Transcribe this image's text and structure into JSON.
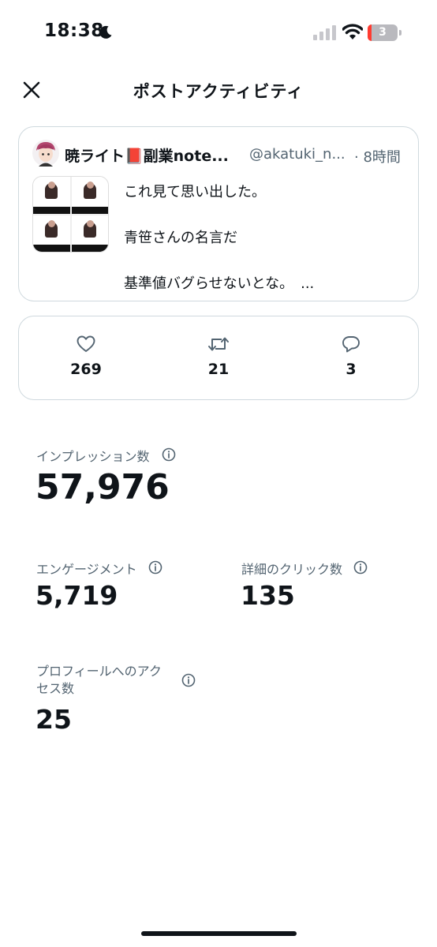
{
  "status_bar": {
    "time": "18:38",
    "battery_level": "3",
    "icons": [
      "moon-icon",
      "signal-icon",
      "wifi-icon",
      "battery-icon"
    ]
  },
  "header": {
    "title": "ポストアクティビティ",
    "close_icon": "close-icon"
  },
  "post": {
    "author_name": "暁ライト📕副業note...",
    "handle": "@akatuki_n...",
    "time": "· 8時間",
    "text_lines": [
      "これ見て思い出した。",
      "",
      "青笹さんの名言だ",
      "",
      "基準値バグらせないとな。　..."
    ]
  },
  "metrics": {
    "likes": "269",
    "reposts": "21",
    "replies": "3"
  },
  "stats": {
    "impressions_label": "インプレッション数",
    "impressions_value": "57,976",
    "engagement_label": "エンゲージメント",
    "engagement_value": "5,719",
    "detail_clicks_label": "詳細のクリック数",
    "detail_clicks_value": "135",
    "profile_visits_label_line1": "プロフィールへのアク",
    "profile_visits_label_line2": "セス数",
    "profile_visits_value": "25"
  },
  "colors": {
    "text_primary": "#0f1419",
    "text_secondary": "#536471",
    "border": "#cfd9de",
    "battery_low": "#ff3b30"
  }
}
